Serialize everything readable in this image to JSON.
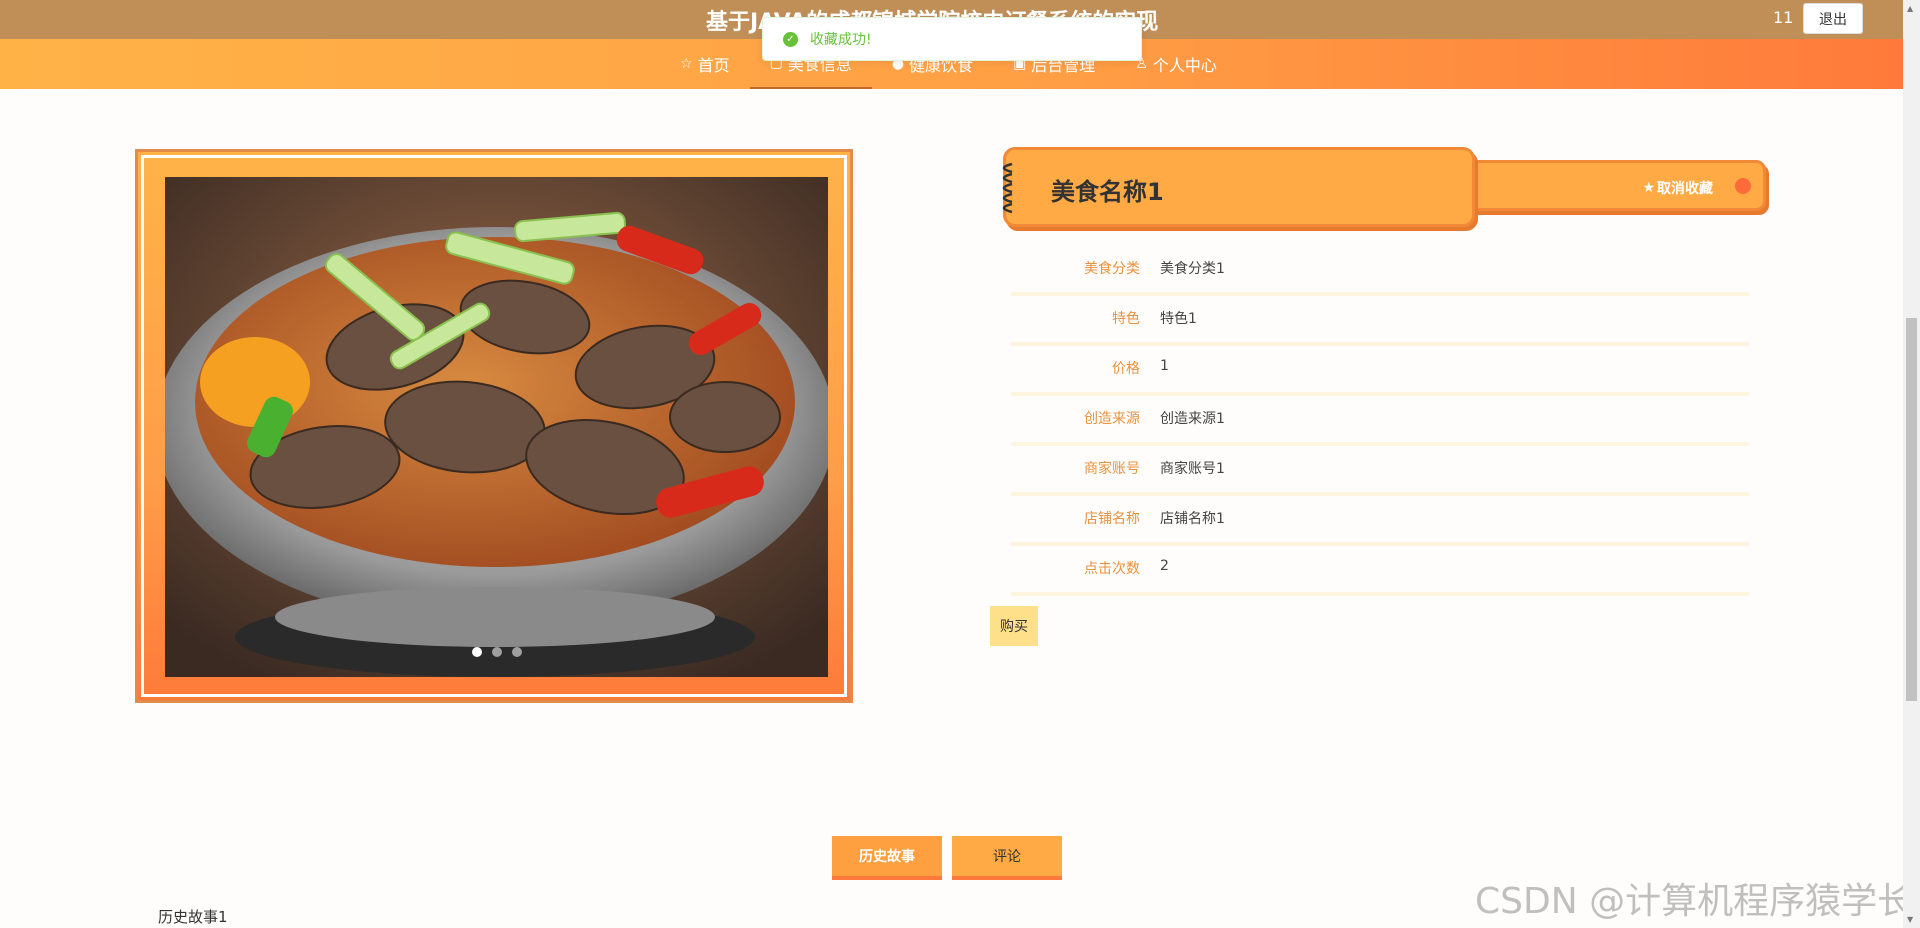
{
  "header": {
    "site_title": "基于JAVA的成都锦城学院校内订餐系统的实现",
    "username": "11",
    "logout_label": "退出"
  },
  "nav": {
    "items": [
      {
        "label": "首页",
        "icon": "star-outline-icon"
      },
      {
        "label": "美食信息",
        "icon": "book-icon",
        "active": true
      },
      {
        "label": "健康饮食",
        "icon": "info-icon"
      },
      {
        "label": "后台管理",
        "icon": "calendar-icon"
      },
      {
        "label": "个人中心",
        "icon": "user-icon"
      }
    ]
  },
  "toast": {
    "message": "收藏成功!",
    "type": "success"
  },
  "carousel": {
    "slide_count": 3,
    "active_index": 0
  },
  "detail": {
    "title": "美食名称1",
    "favorite_label": "取消收藏",
    "rows": [
      {
        "label": "美食分类",
        "value": "美食分类1"
      },
      {
        "label": "特色",
        "value": "特色1"
      },
      {
        "label": "价格",
        "value": "1"
      },
      {
        "label": "创造来源",
        "value": "创造来源1"
      },
      {
        "label": "商家账号",
        "value": "商家账号1"
      },
      {
        "label": "店铺名称",
        "value": "店铺名称1"
      },
      {
        "label": "点击次数",
        "value": "2"
      }
    ],
    "buy_label": "购买"
  },
  "tabs": {
    "history_label": "历史故事",
    "comment_label": "评论",
    "content": "历史故事1"
  },
  "watermark": "CSDN @计算机程序猿学长",
  "colors": {
    "topbar": "#c08f58",
    "nav_start": "#ffb347",
    "nav_end": "#ff7a3a",
    "accent": "#ffaa44",
    "label": "#e8913e",
    "success": "#67c23a"
  }
}
